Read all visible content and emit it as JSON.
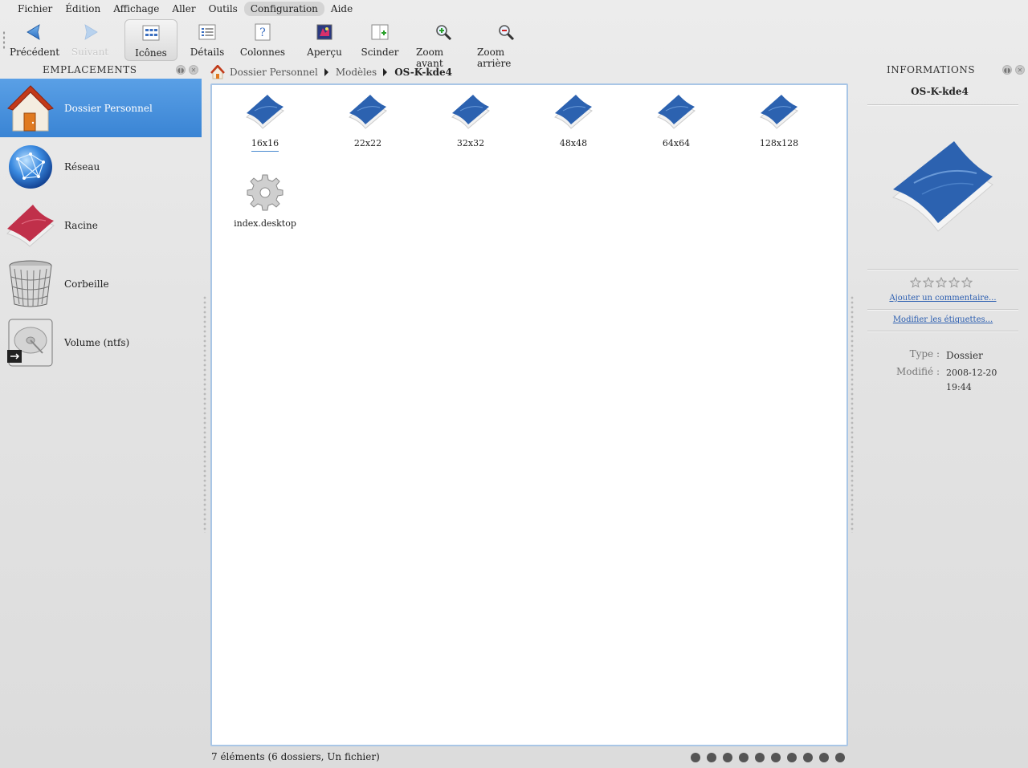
{
  "menubar": {
    "items": [
      "Fichier",
      "Édition",
      "Affichage",
      "Aller",
      "Outils",
      "Configuration",
      "Aide"
    ]
  },
  "toolbar": {
    "back": "Précédent",
    "forward": "Suivant",
    "icons": "Icônes",
    "details": "Détails",
    "columns": "Colonnes",
    "preview": "Aperçu",
    "split": "Scinder",
    "zoom_in": "Zoom avant",
    "zoom_out": "Zoom arrière"
  },
  "places": {
    "title": "EMPLACEMENTS",
    "items": [
      {
        "label": "Dossier Personnel",
        "icon": "home-icon"
      },
      {
        "label": "Réseau",
        "icon": "network-globe-icon"
      },
      {
        "label": "Racine",
        "icon": "root-folder-icon"
      },
      {
        "label": "Corbeille",
        "icon": "trash-icon"
      },
      {
        "label": "Volume (ntfs)",
        "icon": "hard-drive-icon"
      }
    ]
  },
  "breadcrumb": {
    "items": [
      "Dossier Personnel",
      "Modèles"
    ],
    "current": "OS-K-kde4"
  },
  "files": [
    {
      "name": "16x16",
      "type": "folder"
    },
    {
      "name": "22x22",
      "type": "folder"
    },
    {
      "name": "32x32",
      "type": "folder"
    },
    {
      "name": "48x48",
      "type": "folder"
    },
    {
      "name": "64x64",
      "type": "folder"
    },
    {
      "name": "128x128",
      "type": "folder"
    },
    {
      "name": "index.desktop",
      "type": "gear-file"
    }
  ],
  "status": {
    "text": "7 éléments (6 dossiers, Un fichier)",
    "zoom_levels": 10
  },
  "info": {
    "title": "INFORMATIONS",
    "name": "OS-K-kde4",
    "rating": 0,
    "rating_max": 5,
    "add_comment": "Ajouter un commentaire...",
    "edit_tags": "Modifier les étiquettes...",
    "type_label": "Type :",
    "type_value": "Dossier",
    "modified_label": "Modifié :",
    "modified_date": "2008-12-20",
    "modified_time": "19:44"
  },
  "colors": {
    "selection": "#3a84d4",
    "view_border": "#a9c6e6",
    "folder_blue": "#2c62b0",
    "link": "#2a5db0"
  }
}
